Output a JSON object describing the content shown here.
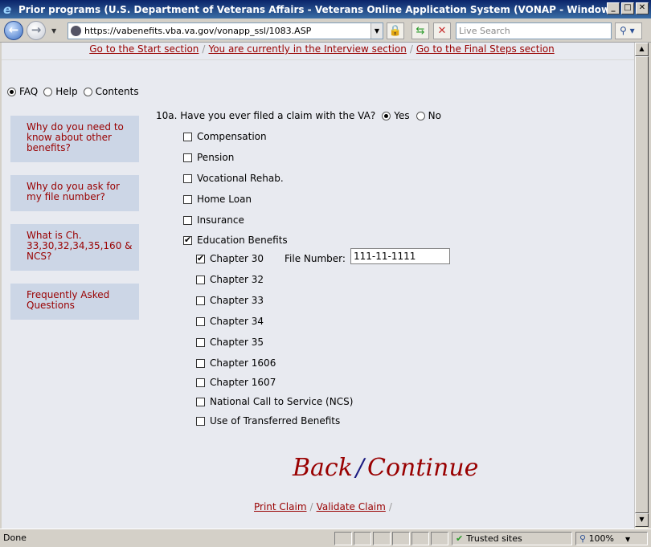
{
  "window": {
    "title": "Prior programs (U.S. Department of Veterans Affairs - Veterans Online Application System (VONAP - Windows Internet Explorer",
    "url": "https://vabenefits.vba.va.gov/vonapp_ssl/1083.ASP",
    "search_placeholder": "Live Search"
  },
  "topnav": {
    "start": "Go to the Start section",
    "interview": "You are currently in the Interview section",
    "final": "Go to the Final Steps section"
  },
  "help_options": [
    "FAQ",
    "Help",
    "Contents"
  ],
  "side_boxes": [
    "Why do you need to know about other benefits?",
    "Why do you ask for my file number?",
    "What is Ch. 33,30,32,34,35,160 & NCS?",
    "Frequently Asked Questions"
  ],
  "question": {
    "text": "10a. Have you ever filed a claim with the VA?",
    "yes": "Yes",
    "no": "No"
  },
  "claims": [
    {
      "label": "Compensation",
      "checked": false
    },
    {
      "label": "Pension",
      "checked": false
    },
    {
      "label": "Vocational Rehab.",
      "checked": false
    },
    {
      "label": "Home Loan",
      "checked": false
    },
    {
      "label": "Insurance",
      "checked": false
    },
    {
      "label": "Education Benefits",
      "checked": true
    }
  ],
  "education": [
    {
      "label": "Chapter 30",
      "checked": true
    },
    {
      "label": "Chapter 32",
      "checked": false
    },
    {
      "label": "Chapter 33",
      "checked": false
    },
    {
      "label": "Chapter 34",
      "checked": false
    },
    {
      "label": "Chapter 35",
      "checked": false
    },
    {
      "label": "Chapter 1606",
      "checked": false
    },
    {
      "label": "Chapter 1607",
      "checked": false
    },
    {
      "label": "National Call to Service (NCS)",
      "checked": false
    },
    {
      "label": "Use of Transferred Benefits",
      "checked": false
    }
  ],
  "file_number": {
    "label": "File Number:",
    "value": "111-11-1111"
  },
  "nav": {
    "back": "Back",
    "slash": "/",
    "continue": "Continue"
  },
  "bottom": {
    "print": "Print Claim",
    "validate": "Validate Claim",
    "sep": "/"
  },
  "status": {
    "text": "Done",
    "zone": "Trusted sites",
    "zoom": "100%"
  }
}
